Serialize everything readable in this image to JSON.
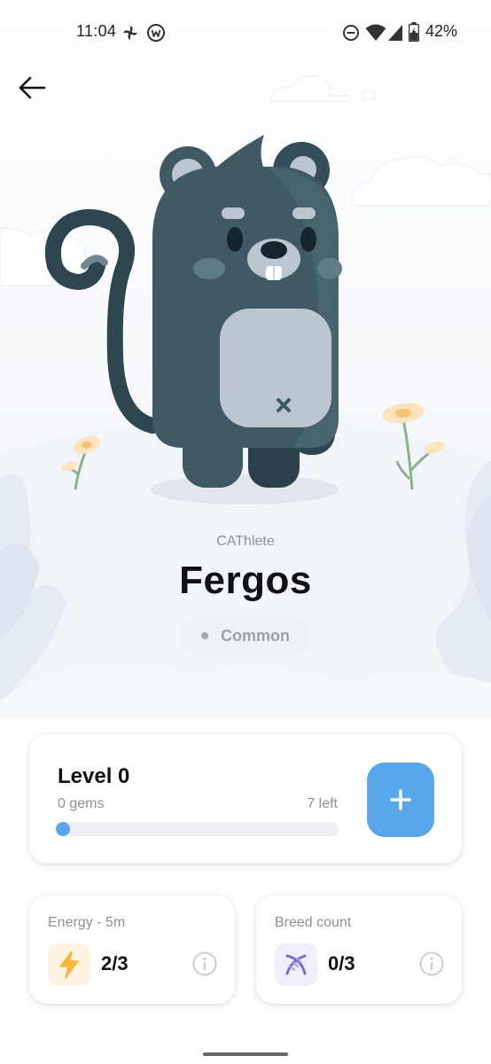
{
  "status_bar": {
    "time": "11:04",
    "battery": "42%",
    "icons": [
      "fan-icon",
      "app-w-icon",
      "do-not-disturb-icon",
      "wifi-icon",
      "cellular-icon",
      "battery-charging-icon"
    ]
  },
  "nav": {
    "back_icon": "arrow-left-icon"
  },
  "character": {
    "type": "CAThlete",
    "name": "Fergos",
    "rarity": "Common"
  },
  "level_card": {
    "title": "Level 0",
    "gems": "0 gems",
    "remaining": "7 left",
    "progress": 0.03,
    "add_icon": "plus-icon"
  },
  "energy_card": {
    "title": "Energy - 5m",
    "value": "2/3",
    "icon": "lightning-icon"
  },
  "breed_card": {
    "title": "Breed count",
    "value": "0/3",
    "icon": "dna-icon"
  },
  "colors": {
    "accent": "#5aa6ea",
    "character_body": "#3f5a64",
    "energy_icon": "#f5b83d",
    "dna_icon": "#7e6cd6"
  }
}
